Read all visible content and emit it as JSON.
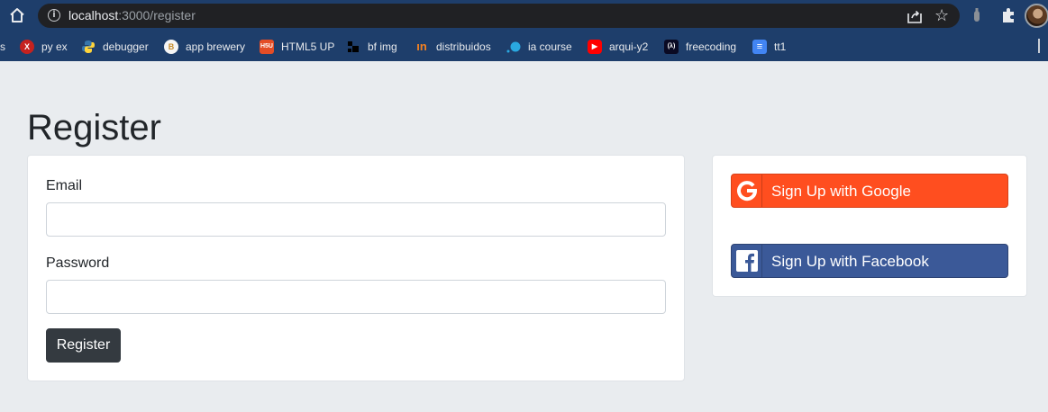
{
  "browser": {
    "url_host": "localhost",
    "url_path": ":3000/register",
    "bookmarks": [
      {
        "label": "s",
        "icon": "bookmark-partial-icon",
        "color": "#1e3e6b",
        "glyph": ""
      },
      {
        "label": "py ex",
        "icon": "py-ex-icon",
        "color": "#c5221f",
        "glyph": "X"
      },
      {
        "label": "debugger",
        "icon": "python-icon",
        "color": "#3572a5",
        "glyph": "Py"
      },
      {
        "label": "app brewery",
        "icon": "app-brewery-icon",
        "color": "#f5f5f5",
        "glyph": "B"
      },
      {
        "label": "HTML5 UP",
        "icon": "html5up-icon",
        "color": "#e44d26",
        "glyph": "H"
      },
      {
        "label": "bf img",
        "icon": "bf-img-icon",
        "color": "#000000",
        "glyph": "▟"
      },
      {
        "label": "distribuidos",
        "icon": "distribuidos-icon",
        "color": "#f48120",
        "glyph": "m"
      },
      {
        "label": "ia course",
        "icon": "ia-course-icon",
        "color": "#2aa8e0",
        "glyph": "●"
      },
      {
        "label": "arqui-y2",
        "icon": "youtube-icon",
        "color": "#ff0000",
        "glyph": "▶"
      },
      {
        "label": "freecoding",
        "icon": "freecodecamp-icon",
        "color": "#0a0a23",
        "glyph": "(λ)"
      },
      {
        "label": "tt1",
        "icon": "google-docs-icon",
        "color": "#4285f4",
        "glyph": "≡"
      }
    ]
  },
  "page": {
    "title": "Register"
  },
  "form": {
    "email_label": "Email",
    "email_value": "",
    "password_label": "Password",
    "password_value": "",
    "submit_label": "Register"
  },
  "social": {
    "google_label": "Sign Up with Google",
    "facebook_label": "Sign Up with Facebook",
    "google_color": "#ff4e1f",
    "facebook_color": "#3b5998"
  }
}
